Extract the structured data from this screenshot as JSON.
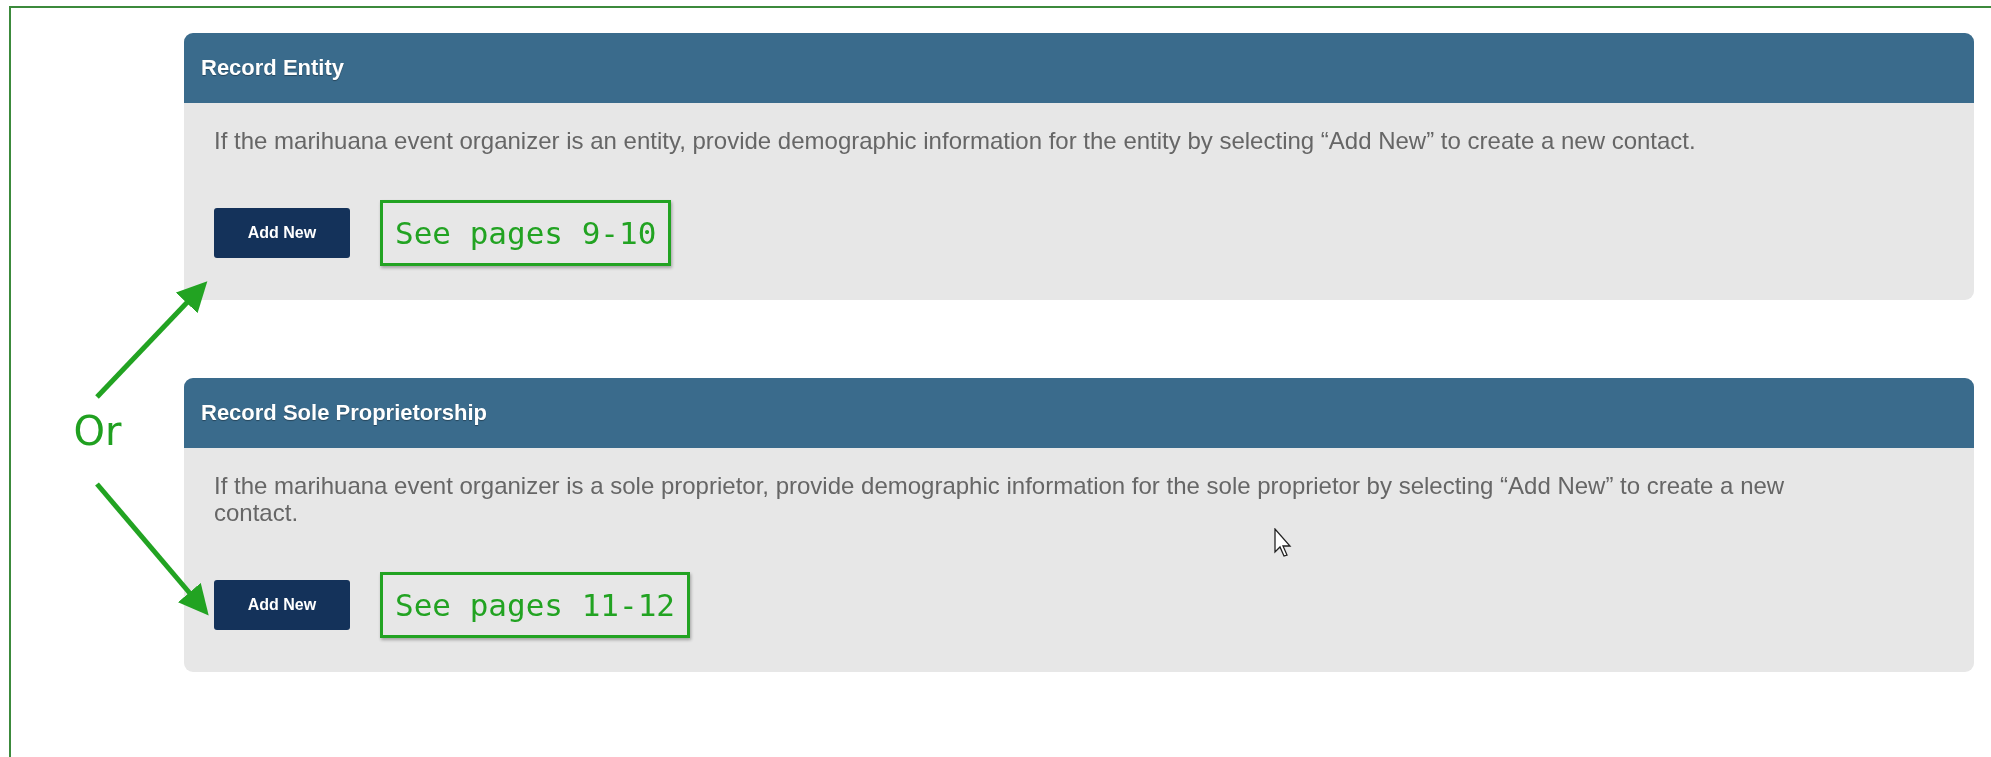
{
  "connector": "Or",
  "panels": [
    {
      "title": "Record Entity",
      "description": "If the marihuana event organizer is an entity, provide demographic information for the entity by selecting “Add New” to create a new contact.",
      "button": "Add New",
      "callout": "See pages 9-10"
    },
    {
      "title": "Record Sole Proprietorship",
      "description": "If the marihuana event organizer is a sole proprietor, provide demographic information for the sole proprietor by selecting “Add New” to create a new contact.",
      "button": "Add New",
      "callout": "See pages 11-12"
    }
  ]
}
